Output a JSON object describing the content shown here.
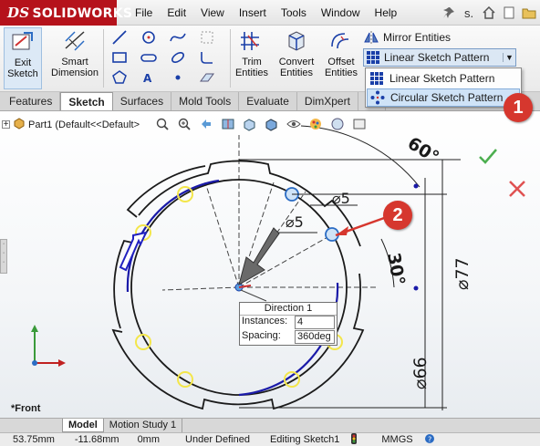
{
  "app": {
    "brand": "SOLIDWORKS",
    "brand_prefix": "DS"
  },
  "menu": [
    "File",
    "Edit",
    "View",
    "Insert",
    "Tools",
    "Window",
    "Help"
  ],
  "title_tools_text": "s.",
  "ribbon": {
    "exit_sketch": [
      "Exit",
      "Sketch"
    ],
    "smart_dimension": [
      "Smart",
      "Dimension"
    ],
    "trim_entities": [
      "Trim",
      "Entities"
    ],
    "convert_entities": [
      "Convert",
      "Entities"
    ],
    "offset_entities": [
      "Offset",
      "Entities"
    ],
    "mirror_entities": "Mirror Entities",
    "pattern_selected": "Linear Sketch Pattern"
  },
  "pattern_dropdown": {
    "items": [
      "Linear Sketch Pattern",
      "Circular Sketch Pattern"
    ],
    "highlighted_index": 1
  },
  "tabs": [
    "Features",
    "Sketch",
    "Surfaces",
    "Mold Tools",
    "Evaluate",
    "DimXpert",
    "Of"
  ],
  "active_tab": "Sketch",
  "tree": {
    "item": "Part1  (Default<<Default>"
  },
  "dimensions": {
    "hole_dia_1": "⌀5",
    "hole_dia_2": "⌀5",
    "angle_top": "60°",
    "angle_side": "30°",
    "outer_dia": "⌀77",
    "inner_dia": "⌀66"
  },
  "direction_box": {
    "title": "Direction 1",
    "instances_label": "Instances:",
    "instances_value": "4",
    "spacing_label": "Spacing:",
    "spacing_value": "360deg"
  },
  "view_label": "*Front",
  "model_tabs": [
    "Model",
    "Motion Study 1"
  ],
  "active_model_tab": "Model",
  "status": {
    "x": "53.75mm",
    "y": "-11.68mm",
    "z": "0mm",
    "state": "Under Defined",
    "mode": "Editing Sketch1",
    "units": "MMGS"
  },
  "callouts": [
    "1",
    "2"
  ],
  "colors": {
    "brand_red": "#b5121b",
    "sketch_blue": "#1a1aa8",
    "highlight_yellow": "#f3e64a",
    "callout_red": "#d6372e",
    "confirm_green": "#4caf50",
    "cancel_red": "#e05252"
  }
}
